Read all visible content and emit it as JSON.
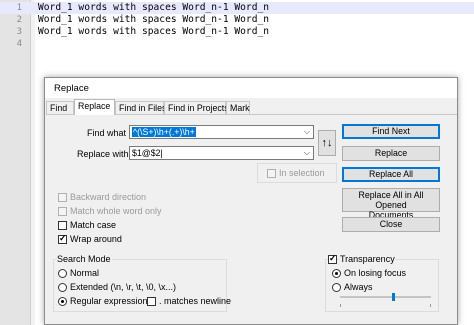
{
  "editor": {
    "lines": [
      {
        "number": "1",
        "text": "Word_1 words with spaces Word_n-1 Word_n"
      },
      {
        "number": "2",
        "text": "Word_1 words with spaces Word_n-1 Word_n"
      },
      {
        "number": "3",
        "text": "Word_1 words with spaces Word_n-1 Word_n"
      },
      {
        "number": "4",
        "text": ""
      }
    ]
  },
  "dialog": {
    "title": "Replace",
    "tabs": [
      "Find",
      "Replace",
      "Find in Files",
      "Find in Projects",
      "Mark"
    ],
    "active_tab": "Replace",
    "find_what_label": "Find what :",
    "find_what_value": "^(\\S+)\\h+(.+)\\h+",
    "replace_with_label": "Replace with :",
    "replace_with_value": "$1@$2|",
    "swap_icon": "↑↓",
    "in_selection_label": "In selection",
    "buttons": {
      "find_next": "Find Next",
      "replace": "Replace",
      "replace_all": "Replace All",
      "replace_all_opened_line1": "Replace All in All Opened",
      "replace_all_opened_line2": "Documents",
      "close": "Close"
    },
    "options": {
      "backward": "Backward direction",
      "whole_word": "Match whole word only",
      "match_case": "Match case",
      "wrap_around": "Wrap around"
    },
    "search_mode": {
      "label": "Search Mode",
      "normal": "Normal",
      "extended": "Extended (\\n, \\r, \\t, \\0, \\x...)",
      "regex": "Regular expression",
      "dot_newline": ". matches newline",
      "selected": "regex"
    },
    "transparency": {
      "label": "Transparency",
      "on_losing_focus": "On losing focus",
      "always": "Always",
      "level_fraction": 0.58
    }
  },
  "colors": {
    "accent": "#0078d7",
    "current_line": "#e8e8ff",
    "gutter": "#e4e4e4"
  }
}
